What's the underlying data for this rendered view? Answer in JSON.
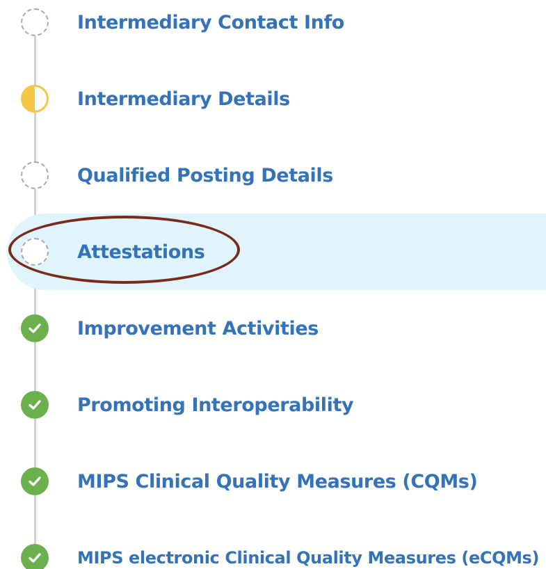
{
  "steps": [
    {
      "label": "Intermediary Contact Info",
      "status": "not-started",
      "icon": "dashed-circle-icon"
    },
    {
      "label": "Intermediary Details",
      "status": "in-progress",
      "icon": "half-filled-circle-icon"
    },
    {
      "label": "Qualified Posting Details",
      "status": "not-started",
      "icon": "dashed-circle-icon"
    },
    {
      "label": "Attestations",
      "status": "not-started",
      "icon": "dashed-circle-icon",
      "active": true
    },
    {
      "label": "Improvement Activities",
      "status": "complete",
      "icon": "check-circle-icon"
    },
    {
      "label": "Promoting Interoperability",
      "status": "complete",
      "icon": "check-circle-icon"
    },
    {
      "label": "MIPS Clinical Quality Measures (CQMs)",
      "status": "complete",
      "icon": "check-circle-icon"
    },
    {
      "label": "MIPS electronic Clinical Quality Measures (eCQMs)",
      "status": "complete",
      "icon": "check-circle-icon"
    }
  ],
  "colors": {
    "label": "#3473b8",
    "active_background": "#dff4fc",
    "in_progress": "#f6c543",
    "complete": "#6ab04c",
    "not_started_border": "#a9a9a9",
    "connector": "#d0d0d0",
    "annotation": "#7a2a1a"
  }
}
